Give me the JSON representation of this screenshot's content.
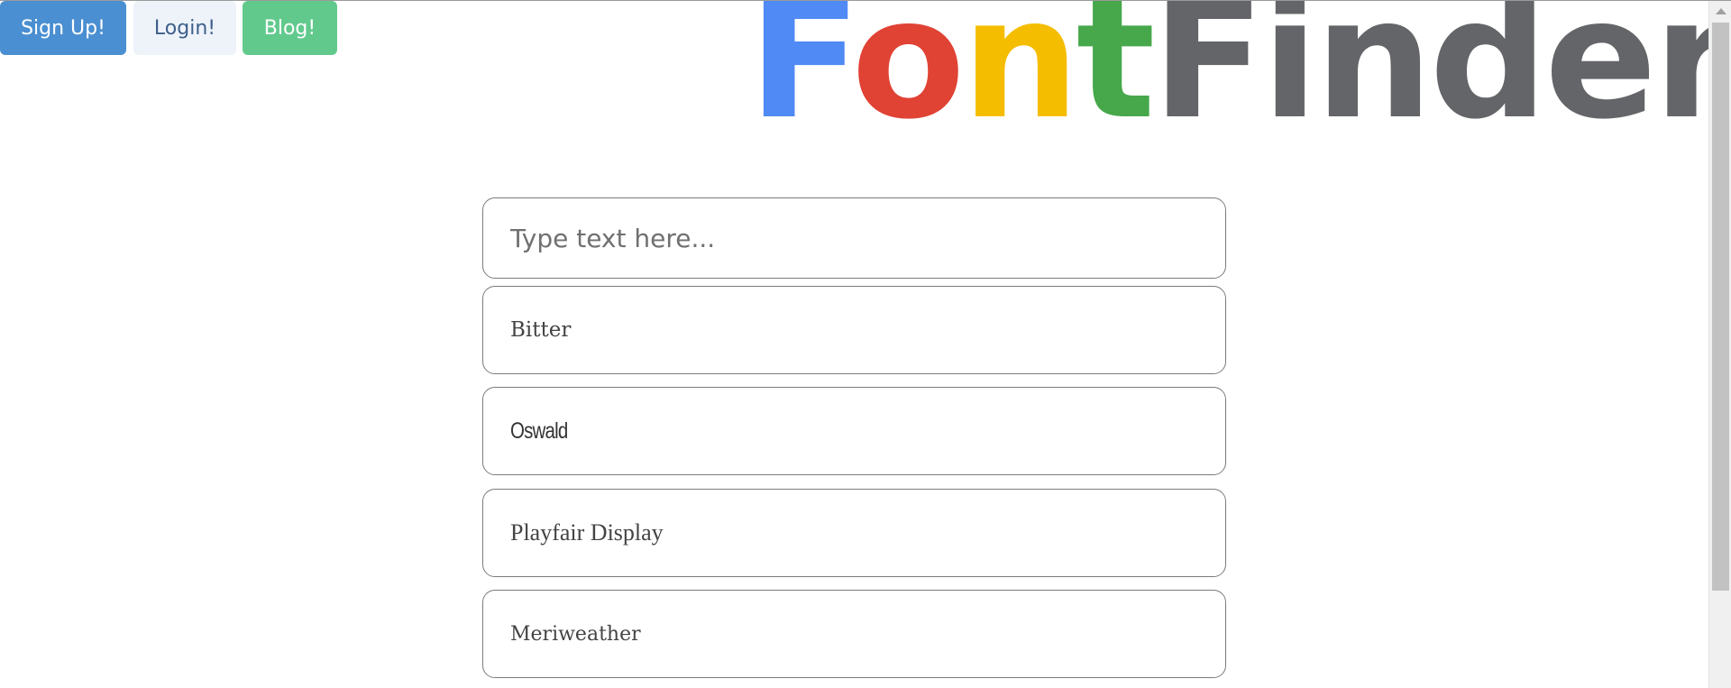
{
  "nav": {
    "signup_label": "Sign Up!",
    "login_label": "Login!",
    "blog_label": "Blog!"
  },
  "logo": {
    "letters": [
      {
        "char": "F",
        "color": "#4f8af5"
      },
      {
        "char": "o",
        "color": "#e04234"
      },
      {
        "char": "n",
        "color": "#f5bd00"
      },
      {
        "char": "t",
        "color": "#46a84b"
      },
      {
        "char": "Finder",
        "color": "#646568"
      }
    ]
  },
  "search": {
    "placeholder": "Type text here...",
    "value": ""
  },
  "fonts": [
    {
      "name": "Bitter"
    },
    {
      "name": "Oswald"
    },
    {
      "name": "Playfair Display"
    },
    {
      "name": "Meriweather"
    }
  ],
  "colors": {
    "signup_bg": "#4a8fd1",
    "login_bg": "#eef3fa",
    "blog_bg": "#62c98d"
  }
}
